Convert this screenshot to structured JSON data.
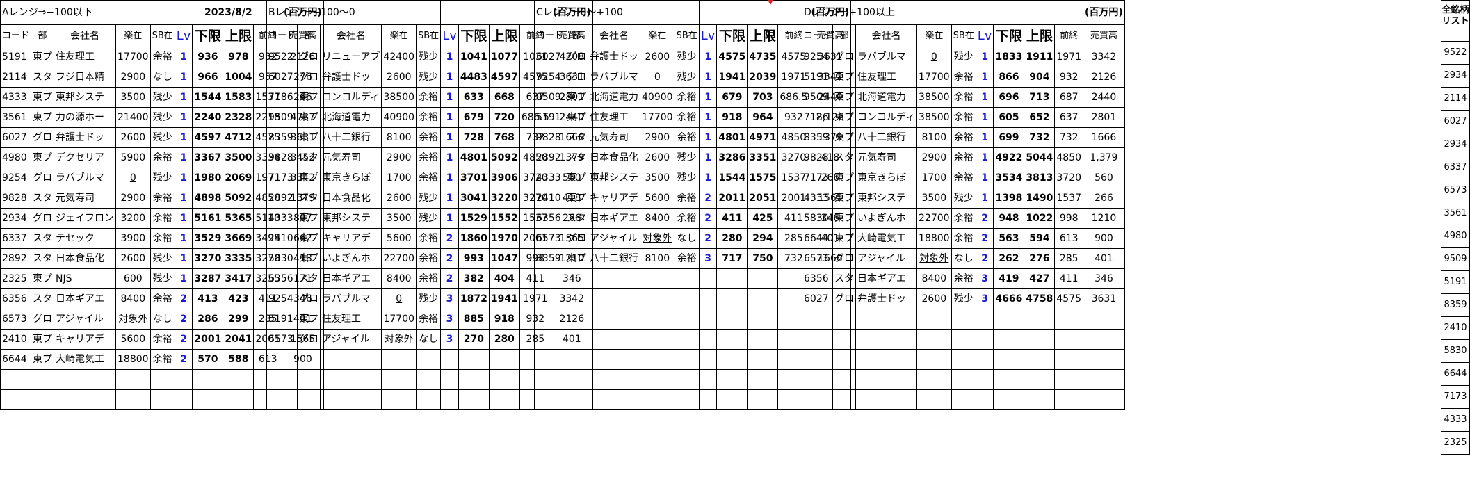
{
  "header": {
    "date": "2023/8/2",
    "unit": "(百万円)",
    "list_title": "全銘柄リスト"
  },
  "columns": {
    "code": "コード",
    "dept": "部",
    "company": "会社名",
    "stock": "楽在",
    "sb": "SB在",
    "lv": "Lv",
    "lower": "下限",
    "upper": "上限",
    "prev": "前終",
    "sales": "売買高"
  },
  "blocks": [
    {
      "title": "Aレンジ⇒−100以下",
      "rows": [
        [
          "5191",
          "東プ",
          "住友理工",
          "17700",
          "余裕",
          "1",
          "936",
          "978",
          "932",
          "2126"
        ],
        [
          "2114",
          "スタ",
          "フジ日本精",
          "2900",
          "なし",
          "1",
          "966",
          "1004",
          "957",
          "276"
        ],
        [
          "4333",
          "東プ",
          "東邦システ",
          "3500",
          "残少",
          "1",
          "1544",
          "1583",
          "1537",
          "266"
        ],
        [
          "3561",
          "東プ",
          "力の源ホー",
          "21400",
          "残少",
          "1",
          "2240",
          "2328",
          "2218",
          "4737"
        ],
        [
          "6027",
          "グロ",
          "弁護士ドッ",
          "2600",
          "残少",
          "1",
          "4597",
          "4712",
          "4575",
          "3631"
        ],
        [
          "4980",
          "東プ",
          "デクセリア",
          "5900",
          "余裕",
          "1",
          "3367",
          "3500",
          "3334",
          "3452"
        ],
        [
          "9254",
          "グロ",
          "ラバブルマ",
          "0",
          "残少",
          "1",
          "1980",
          "2069",
          "1971",
          "3342"
        ],
        [
          "9828",
          "スタ",
          "元気寿司",
          "2900",
          "余裕",
          "1",
          "4898",
          "5092",
          "4850",
          "1379"
        ],
        [
          "2934",
          "グロ",
          "ジェイフロン",
          "3200",
          "余裕",
          "1",
          "5161",
          "5365",
          "5110",
          "807"
        ],
        [
          "6337",
          "スタ",
          "テセック",
          "3900",
          "余裕",
          "1",
          "3529",
          "3669",
          "3495",
          "662"
        ],
        [
          "2892",
          "スタ",
          "日本食品化",
          "2600",
          "残少",
          "1",
          "3270",
          "3335",
          "3270",
          "418"
        ],
        [
          "2325",
          "東プ",
          "NJS",
          "600",
          "残少",
          "1",
          "3287",
          "3417",
          "3255",
          "171"
        ],
        [
          "6356",
          "スタ",
          "日本ギアエ",
          "8400",
          "余裕",
          "2",
          "413",
          "423",
          "411",
          "346"
        ],
        [
          "6573",
          "グロ",
          "アジャイル",
          "対象外",
          "なし",
          "2",
          "286",
          "299",
          "285",
          "401"
        ],
        [
          "2410",
          "東プ",
          "キャリアデ",
          "5600",
          "余裕",
          "2",
          "2001",
          "2041",
          "2001",
          "1565"
        ],
        [
          "6644",
          "東プ",
          "大崎電気工",
          "18800",
          "余裕",
          "2",
          "570",
          "588",
          "613",
          "900"
        ]
      ]
    },
    {
      "title": "Bレンジ⇒−100〜0",
      "rows": [
        [
          "9522",
          "グロ",
          "リニューアブ",
          "42400",
          "残少",
          "1",
          "1041",
          "1077",
          "1031",
          "4208"
        ],
        [
          "6027",
          "グロ",
          "弁護士ドッ",
          "2600",
          "残少",
          "1",
          "4483",
          "4597",
          "4575",
          "3631"
        ],
        [
          "7186",
          "東プ",
          "コンコルディ",
          "38500",
          "余裕",
          "1",
          "633",
          "668",
          "637",
          "2801"
        ],
        [
          "9509",
          "東プ",
          "北海道電力",
          "40900",
          "余裕",
          "1",
          "679",
          "720",
          "686.5",
          "2440"
        ],
        [
          "8359",
          "東プ",
          "八十二銀行",
          "8100",
          "余裕",
          "1",
          "728",
          "768",
          "732",
          "1666"
        ],
        [
          "9828",
          "スタ",
          "元気寿司",
          "2900",
          "余裕",
          "1",
          "4801",
          "5092",
          "4850",
          "1379"
        ],
        [
          "7173",
          "東プ",
          "東京きらぼ",
          "1700",
          "余裕",
          "1",
          "3701",
          "3906",
          "3720",
          "560"
        ],
        [
          "2892",
          "スタ",
          "日本食品化",
          "2600",
          "残少",
          "1",
          "3041",
          "3220",
          "3270",
          "418"
        ],
        [
          "4333",
          "東プ",
          "東邦システ",
          "3500",
          "残少",
          "1",
          "1529",
          "1552",
          "1537",
          "266"
        ],
        [
          "2410",
          "東プ",
          "キャリアデ",
          "5600",
          "余裕",
          "2",
          "1860",
          "1970",
          "2001",
          "1565"
        ],
        [
          "5830",
          "東プ",
          "いよぎんホ",
          "22700",
          "余裕",
          "2",
          "993",
          "1047",
          "998",
          "1210"
        ],
        [
          "6356",
          "スタ",
          "日本ギアエ",
          "8400",
          "余裕",
          "2",
          "382",
          "404",
          "411",
          "346"
        ],
        [
          "9254",
          "グロ",
          "ラバブルマ",
          "0",
          "残少",
          "3",
          "1872",
          "1941",
          "1971",
          "3342"
        ],
        [
          "5191",
          "東プ",
          "住友理工",
          "17700",
          "余裕",
          "3",
          "885",
          "918",
          "932",
          "2126"
        ],
        [
          "6573",
          "グロ",
          "アジャイル",
          "対象外",
          "なし",
          "3",
          "270",
          "280",
          "285",
          "401"
        ]
      ]
    },
    {
      "title": "Cレンジ⇒0〜+100",
      "rows": [
        [
          "6027",
          "グロ",
          "弁護士ドッ",
          "2600",
          "残少",
          "1",
          "4575",
          "4735",
          "4575",
          "3631"
        ],
        [
          "9254",
          "グロ",
          "ラバブルマ",
          "0",
          "残少",
          "1",
          "1941",
          "2039",
          "1971",
          "3342"
        ],
        [
          "9509",
          "東プ",
          "北海道電力",
          "40900",
          "余裕",
          "1",
          "679",
          "703",
          "686.5",
          "2440"
        ],
        [
          "5191",
          "東プ",
          "住友理工",
          "17700",
          "余裕",
          "1",
          "918",
          "964",
          "932",
          "2,126"
        ],
        [
          "9828",
          "スタ",
          "元気寿司",
          "2900",
          "余裕",
          "1",
          "4801",
          "4971",
          "4850",
          "1379"
        ],
        [
          "2892",
          "スタ",
          "日本食品化",
          "2600",
          "残少",
          "1",
          "3286",
          "3351",
          "3270",
          "418"
        ],
        [
          "4333",
          "東プ",
          "東邦システ",
          "3500",
          "残少",
          "1",
          "1544",
          "1575",
          "1537",
          "266"
        ],
        [
          "2410",
          "東プ",
          "キャリアデ",
          "5600",
          "余裕",
          "2",
          "2011",
          "2051",
          "2001",
          "1565"
        ],
        [
          "6356",
          "スタ",
          "日本ギアエ",
          "8400",
          "余裕",
          "2",
          "411",
          "425",
          "411",
          "346"
        ],
        [
          "6573",
          "グロ",
          "アジャイル",
          "対象外",
          "なし",
          "2",
          "280",
          "294",
          "285",
          "401"
        ],
        [
          "8359",
          "東プ",
          "八十二銀行",
          "8100",
          "余裕",
          "3",
          "717",
          "750",
          "732",
          "1666"
        ]
      ]
    },
    {
      "title": "Dレンジ⇒+100以上",
      "rows": [
        [
          "9254",
          "グロ",
          "ラバブルマ",
          "0",
          "残少",
          "1",
          "1833",
          "1911",
          "1971",
          "3342"
        ],
        [
          "5191",
          "東プ",
          "住友理工",
          "17700",
          "余裕",
          "1",
          "866",
          "904",
          "932",
          "2126"
        ],
        [
          "9509",
          "東プ",
          "北海道電力",
          "38500",
          "余裕",
          "1",
          "696",
          "713",
          "687",
          "2440"
        ],
        [
          "7186",
          "東プ",
          "コンコルディ",
          "38500",
          "余裕",
          "1",
          "605",
          "652",
          "637",
          "2801"
        ],
        [
          "8359",
          "東プ",
          "八十二銀行",
          "8100",
          "余裕",
          "1",
          "699",
          "732",
          "732",
          "1666"
        ],
        [
          "9828",
          "スタ",
          "元気寿司",
          "2900",
          "余裕",
          "1",
          "4922",
          "5044",
          "4850",
          "1,379"
        ],
        [
          "7173",
          "東プ",
          "東京きらぼ",
          "1700",
          "余裕",
          "1",
          "3534",
          "3813",
          "3720",
          "560"
        ],
        [
          "4333",
          "東プ",
          "東邦システ",
          "3500",
          "残少",
          "1",
          "1398",
          "1490",
          "1537",
          "266"
        ],
        [
          "5830",
          "東プ",
          "いよぎんホ",
          "22700",
          "余裕",
          "2",
          "948",
          "1022",
          "998",
          "1210"
        ],
        [
          "6644",
          "東プ",
          "大崎電気工",
          "18800",
          "余裕",
          "2",
          "563",
          "594",
          "613",
          "900"
        ],
        [
          "6573",
          "グロ",
          "アジャイル",
          "対象外",
          "なし",
          "2",
          "262",
          "276",
          "285",
          "401"
        ],
        [
          "6356",
          "スタ",
          "日本ギアエ",
          "8400",
          "余裕",
          "3",
          "419",
          "427",
          "411",
          "346"
        ],
        [
          "6027",
          "グロ",
          "弁護士ドッ",
          "2600",
          "残少",
          "3",
          "4666",
          "4758",
          "4575",
          "3631"
        ]
      ]
    }
  ],
  "stock_list": [
    "9522",
    "2934",
    "2114",
    "6027",
    "2934",
    "6337",
    "6573",
    "3561",
    "4980",
    "9509",
    "5191",
    "8359",
    "2410",
    "5830",
    "6644",
    "7173",
    "4333",
    "2325"
  ],
  "colors": {
    "lv_blue": "#1a1ad1",
    "tick_red": "#e02020"
  }
}
